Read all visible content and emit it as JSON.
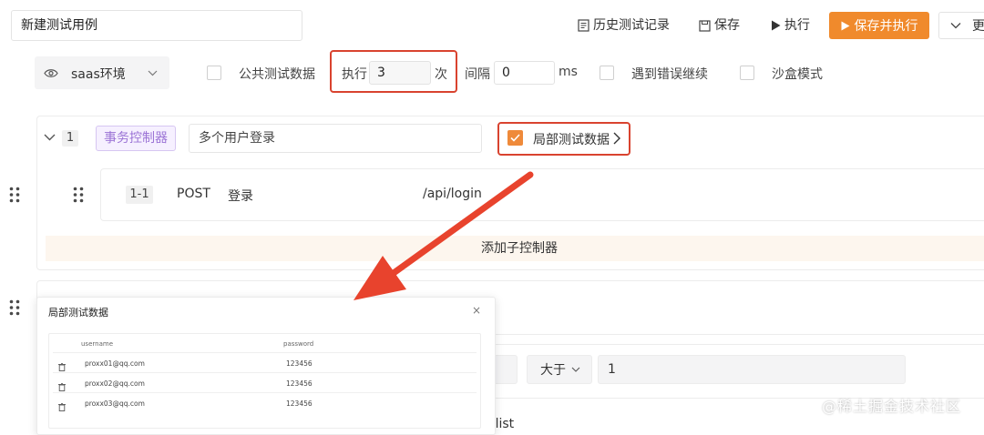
{
  "header": {
    "case_name": "新建测试用例",
    "history_label": "历史测试记录",
    "save_label": "保存",
    "run_label": "执行",
    "save_run_label": "保存并执行",
    "more_label": "更"
  },
  "options": {
    "env_label": "saas环境",
    "public_data_label": "公共测试数据",
    "exec_label": "执行",
    "exec_count": "3",
    "exec_unit": "次",
    "interval_label": "间隔",
    "interval_value": "0",
    "interval_unit": "ms",
    "continue_on_error_label": "遇到错误继续",
    "sandbox_label": "沙盒模式"
  },
  "controller": {
    "index": "1",
    "type_tag": "事务控制器",
    "name": "多个用户登录",
    "local_data_label": "局部测试数据",
    "step": {
      "index": "1-1",
      "method": "POST",
      "name": "登录",
      "path": "/api/login"
    },
    "add_child_label": "添加子控制器"
  },
  "popup": {
    "title": "局部测试数据",
    "close": "×",
    "columns": [
      "username",
      "password"
    ],
    "rows": [
      {
        "username": "proxx01@qq.com",
        "password": "123456"
      },
      {
        "username": "proxx02@qq.com",
        "password": "123456"
      },
      {
        "username": "proxx03@qq.com",
        "password": "123456"
      }
    ]
  },
  "condition": {
    "operator": "大于",
    "value": "1",
    "partial_path": "p/list"
  },
  "watermark": "@稀土掘金技术社区",
  "colors": {
    "accent": "#f08a2c",
    "highlight_border": "#d9432f",
    "tag_purple": "#9b73d6"
  }
}
